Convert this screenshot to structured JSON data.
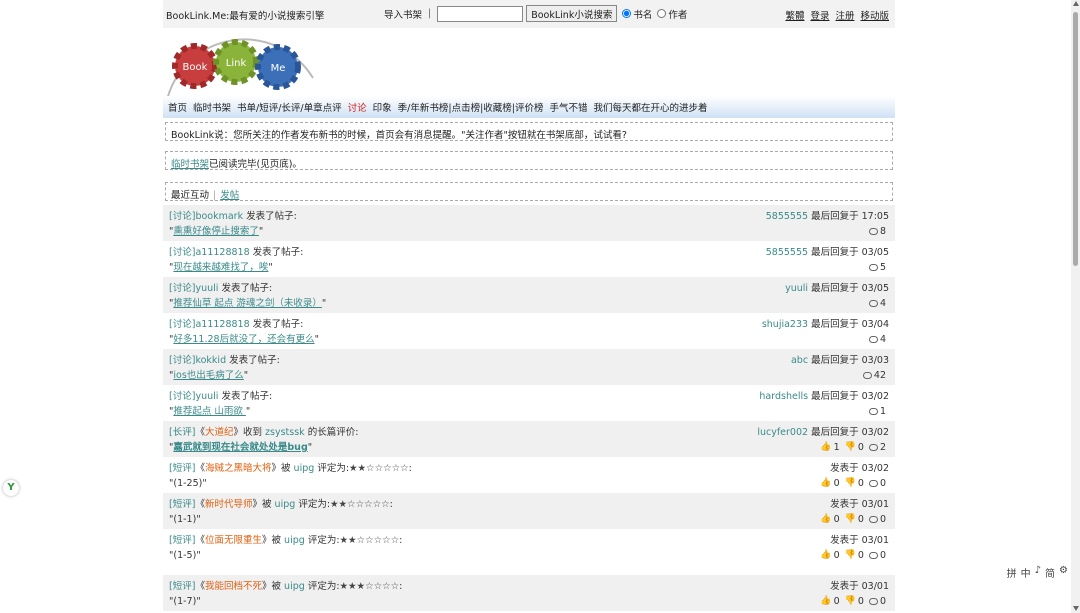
{
  "top": {
    "brand": "BookLink.Me:最有爱的小说搜索引擎",
    "import_label": "导入书架",
    "separator": "|",
    "search_value": "",
    "search_button": "BookLink小说搜索",
    "radio_bookname": "书名",
    "radio_author": "作者",
    "links": [
      "繁體",
      "登录",
      "注册",
      "移动版"
    ]
  },
  "logo": {
    "w1": "Book",
    "w2": "Link",
    "w3": "Me"
  },
  "nav": {
    "items": [
      "首页",
      "临时书架",
      "书单/短评/长评/单章点评",
      "讨论",
      "印象",
      "季/年新书榜|点击榜|收藏榜|评价榜",
      "手气不错",
      "我们每天都在开心的进步着"
    ],
    "active_index": 3
  },
  "notice1": "BookLink说：您所关注的作者发布新书的时候，首页会有消息提醒。\"关注作者\"按钮就在书架底部，试试看?",
  "notice2": {
    "link": "临时书架",
    "text": "已阅读完毕(见页底)。"
  },
  "tabs": {
    "current": "最近互动",
    "bar": "|",
    "post": "发帖"
  },
  "colors": {
    "accent": "#3a8a8a",
    "book": "#e06010",
    "active_nav": "#d42020"
  },
  "feed": [
    {
      "cat": "讨论",
      "user": "bookmark",
      "action": "发表了帖子:",
      "title": "熏熏好像停止搜索了",
      "reply_user": "5855555",
      "reply_text": "最后回复于 17:05",
      "comments": "8"
    },
    {
      "cat": "讨论",
      "user": "a11128818",
      "action": "发表了帖子:",
      "title": "现在越来越难找了，唉",
      "reply_user": "5855555",
      "reply_text": "最后回复于 03/05",
      "comments": "5"
    },
    {
      "cat": "讨论",
      "user": "yuuli",
      "action": "发表了帖子:",
      "title": "推荐仙草 起点 游魂之剑（未收录）",
      "reply_user": "yuuli",
      "reply_text": "最后回复于 03/05",
      "comments": "4"
    },
    {
      "cat": "讨论",
      "user": "a11128818",
      "action": "发表了帖子:",
      "title": "好多11.28后就没了，还会有更么",
      "reply_user": "shujia233",
      "reply_text": "最后回复于 03/04",
      "comments": "4"
    },
    {
      "cat": "讨论",
      "user": "kokkid",
      "action": "发表了帖子:",
      "title": "ios也出毛病了么",
      "reply_user": "abc",
      "reply_text": "最后回复于 03/03",
      "comments": "42"
    },
    {
      "cat": "讨论",
      "user": "yuuli",
      "action": "发表了帖子:",
      "title": "推荐起点 山雨欲 ",
      "reply_user": "hardshells",
      "reply_text": "最后回复于 03/02",
      "comments": "1"
    }
  ],
  "long_review": {
    "cat": "长评",
    "book": "大道纪",
    "mid": "收到",
    "user": "zsystssk",
    "action": "的长篇评价:",
    "title": "嘉武就到现在社会就处处是bug",
    "reply_user": "lucyfer002",
    "reply_text": "最后回复于 03/02",
    "up": "1",
    "down": "0",
    "comments": "2"
  },
  "short_reviews": [
    {
      "cat": "短评",
      "book": "海贼之黑暗大将",
      "by": "被",
      "user": "uipg",
      "rate": "评定为:",
      "stars": "★★☆☆☆☆☆",
      "colon": ":",
      "quote": "(1-25)",
      "date": "发表于 03/02",
      "up": "0",
      "down": "0",
      "comments": "0"
    },
    {
      "cat": "短评",
      "book": "新时代导师",
      "by": "被",
      "user": "uipg",
      "rate": "评定为:",
      "stars": "★★☆☆☆☆☆",
      "colon": ":",
      "quote": "(1-1)",
      "date": "发表于 03/01",
      "up": "0",
      "down": "0",
      "comments": "0"
    },
    {
      "cat": "短评",
      "book": "位面无限重生",
      "by": "被",
      "user": "uipg",
      "rate": "评定为:",
      "stars": "★★☆☆☆☆☆",
      "colon": ":",
      "quote": "(1-5)",
      "date": "发表于 03/01",
      "up": "0",
      "down": "0",
      "comments": "0"
    },
    {
      "cat": "短评",
      "book": "我能回档不死",
      "by": "被",
      "user": "uipg",
      "rate": "评定为:",
      "stars": "★★★☆☆☆☆",
      "colon": ":",
      "quote": "(1-7)",
      "date": "发表于 03/01",
      "up": "0",
      "down": "0",
      "comments": "0"
    }
  ],
  "side_badge": "Y",
  "ime": [
    "拼",
    "中",
    "♪",
    "简",
    "⚙"
  ]
}
